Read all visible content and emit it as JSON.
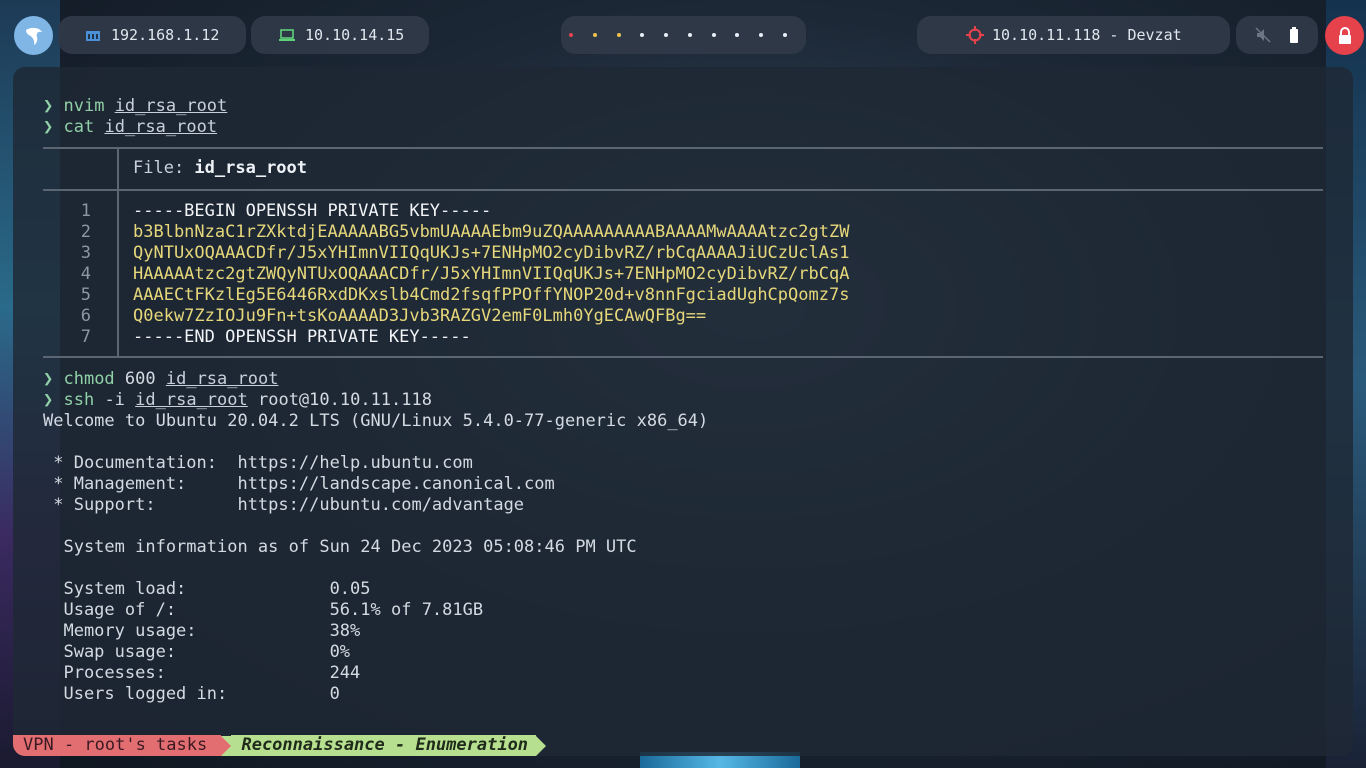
{
  "topbar": {
    "logo_icon": "kali-dragon-icon",
    "host_ip": "192.168.1.12",
    "vpn_ip": "10.10.14.15",
    "workspace_dots": 10,
    "target": "10.10.11.118 - Devzat",
    "accent_colors": {
      "red": "#e6424b",
      "yellow": "#f2c14e",
      "logo": "#7fb6e6"
    }
  },
  "terminal": {
    "cmd1": {
      "cmd": "nvim",
      "arg": "id_rsa_root"
    },
    "cmd2": {
      "cmd": "cat",
      "arg": "id_rsa_root"
    },
    "file_label": "File: ",
    "file_name": "id_rsa_root",
    "file_lines": [
      {
        "n": "1",
        "t": "-----BEGIN OPENSSH PRIVATE KEY-----"
      },
      {
        "n": "2",
        "t": "b3BlbnNzaC1rZXktdjEAAAAABG5vbmUAAAAEbm9uZQAAAAAAAAABAAAAMwAAAAtzc2gtZW"
      },
      {
        "n": "3",
        "t": "QyNTUxOQAAACDfr/J5xYHImnVIIQqUKJs+7ENHpMO2cyDibvRZ/rbCqAAAAJiUCzUclAs1"
      },
      {
        "n": "4",
        "t": "HAAAAAtzc2gtZWQyNTUxOQAAACDfr/J5xYHImnVIIQqUKJs+7ENHpMO2cyDibvRZ/rbCqA"
      },
      {
        "n": "5",
        "t": "AAAECtFKzlEg5E6446RxdDKxslb4Cmd2fsqfPPOffYNOP20d+v8nnFgciadUghCpQomz7s"
      },
      {
        "n": "6",
        "t": "Q0ekw7ZzIOJu9Fn+tsKoAAAAD3Jvb3RAZGV2emF0Lmh0YgECAwQFBg=="
      },
      {
        "n": "7",
        "t": "-----END OPENSSH PRIVATE KEY-----"
      }
    ],
    "cmd3": {
      "cmd": "chmod",
      "pre": " 600 ",
      "arg": "id_rsa_root"
    },
    "cmd4": {
      "cmd": "ssh",
      "pre": " -i ",
      "arg": "id_rsa_root",
      "post": " root@10.10.11.118"
    },
    "welcome": "Welcome to Ubuntu 20.04.2 LTS (GNU/Linux 5.4.0-77-generic x86_64)",
    "links": [
      " * Documentation:  https://help.ubuntu.com",
      " * Management:     https://landscape.canonical.com",
      " * Support:        https://ubuntu.com/advantage"
    ],
    "sysinfo_header": "  System information as of Sun 24 Dec 2023 05:08:46 PM UTC",
    "sysinfo": [
      "  System load:              0.05",
      "  Usage of /:               56.1% of 7.81GB",
      "  Memory usage:             38%",
      "  Swap usage:               0%",
      "  Processes:                244",
      "  Users logged in:          0"
    ]
  },
  "statusbar": {
    "session": "VPN - root's tasks ",
    "window": "Reconnaissance - Enumeration"
  }
}
